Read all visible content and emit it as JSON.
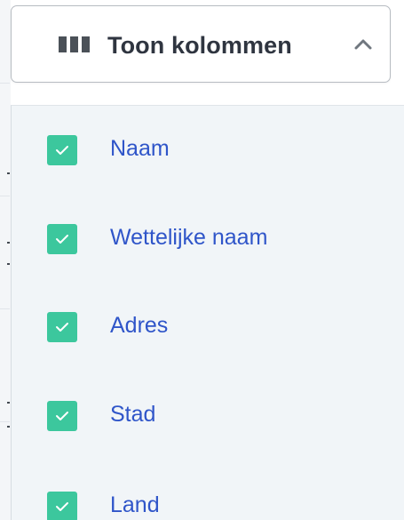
{
  "column_toggle": {
    "label": "Toon kolommen",
    "expanded": true,
    "icon": "columns-icon",
    "chevron_icon": "chevron-up-icon",
    "text_color": "#2f3540",
    "border_color": "#b7bcc2"
  },
  "column_options": {
    "checkbox_color": "#3cc79d",
    "label_color": "#2f55c9",
    "items": [
      {
        "label": "Naam",
        "checked": true
      },
      {
        "label": "Wettelijke naam",
        "checked": true
      },
      {
        "label": "Adres",
        "checked": true
      },
      {
        "label": "Stad",
        "checked": true
      },
      {
        "label": "Land",
        "checked": true
      }
    ]
  }
}
